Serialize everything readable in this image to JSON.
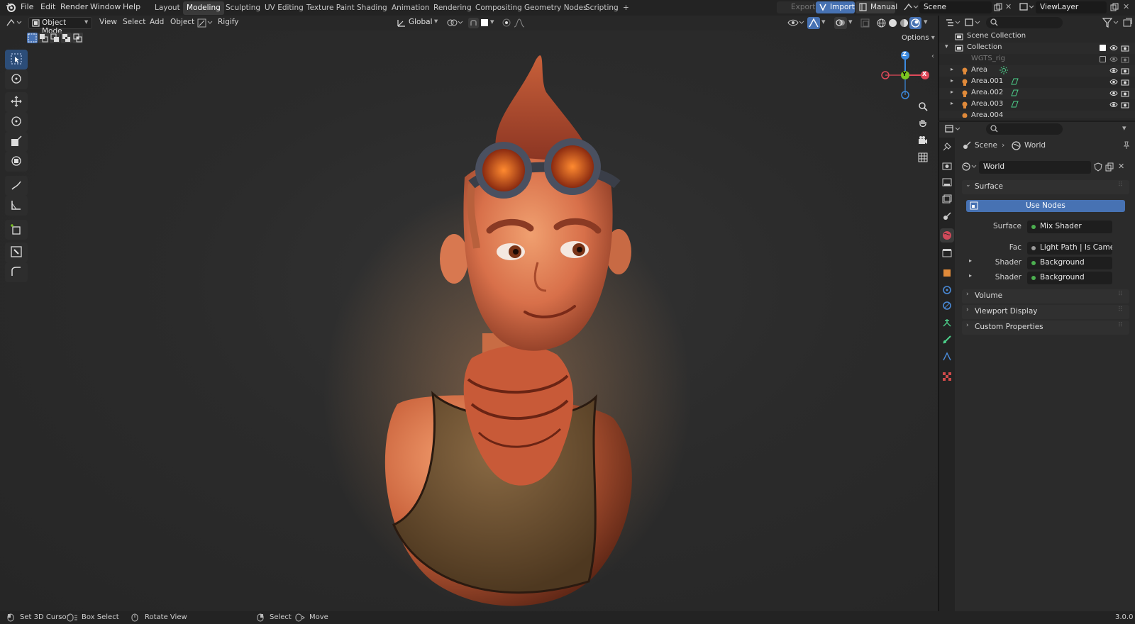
{
  "topbar": {
    "menus": [
      "File",
      "Edit",
      "Render",
      "Window",
      "Help"
    ],
    "workspaces": [
      "Layout",
      "Modeling",
      "Sculpting",
      "UV Editing",
      "Texture Paint",
      "Shading",
      "Animation",
      "Rendering",
      "Compositing",
      "Geometry Nodes",
      "Scripting"
    ],
    "active_workspace": "Modeling",
    "add_workspace": "+",
    "export_label": "Export",
    "import_label": "Import",
    "manual_label": "Manual",
    "scene_name": "Scene",
    "view_layer": "ViewLayer"
  },
  "viewport_header": {
    "mode": "Object Mode",
    "menus": [
      "View",
      "Select",
      "Add",
      "Object"
    ],
    "addon": "Rigify",
    "orientation": "Global",
    "options_label": "Options"
  },
  "gizmo": {
    "z": "Z",
    "y": "Y",
    "x": "X"
  },
  "outliner": {
    "root": "Scene Collection",
    "collection": "Collection",
    "rows": [
      {
        "name": "WGTS_rig",
        "disabled": true
      },
      {
        "name": "Area"
      },
      {
        "name": "Area.001"
      },
      {
        "name": "Area.002"
      },
      {
        "name": "Area.003"
      },
      {
        "name": "Area.004"
      }
    ]
  },
  "properties": {
    "breadcrumb_scene": "Scene",
    "breadcrumb_world": "World",
    "world_name": "World",
    "panels": {
      "surface": "Surface",
      "use_nodes": "Use Nodes",
      "volume": "Volume",
      "viewport_display": "Viewport Display",
      "custom_properties": "Custom Properties"
    },
    "rows": [
      {
        "label": "Surface",
        "value": "Mix Shader",
        "dot": "#4caf50"
      },
      {
        "label": "Fac",
        "value": "Light Path | Is Camera ...",
        "dot": "#9a9a9a"
      },
      {
        "label": "Shader",
        "value": "Background",
        "dot": "#4caf50"
      },
      {
        "label": "Shader",
        "value": "Background",
        "dot": "#4caf50"
      }
    ]
  },
  "statusbar": {
    "set_cursor": "Set 3D Cursor",
    "box_select": "Box Select",
    "rotate_view": "Rotate View",
    "select": "Select",
    "move": "Move",
    "version": "3.0.0"
  },
  "colors": {
    "accent_blue": "#4772b3",
    "axis_x": "#e04a5a",
    "axis_y": "#7bc520",
    "axis_z": "#3d8be0",
    "skin": "#e07a4a"
  }
}
